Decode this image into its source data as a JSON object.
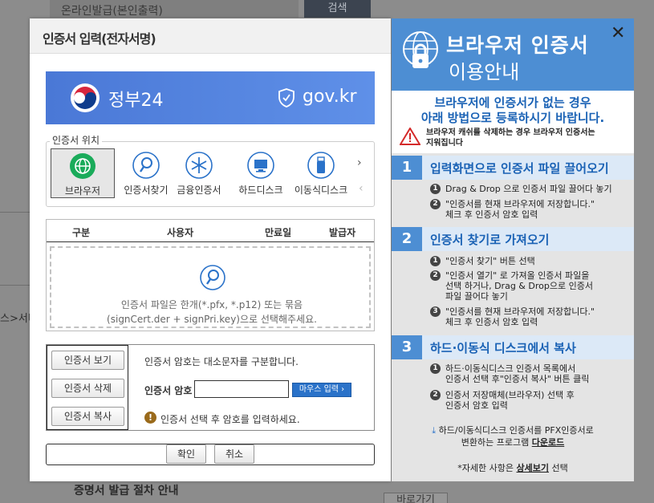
{
  "background": {
    "row_label": "온라인발급(본인출력)",
    "search_label": "검색",
    "crumb": "스>서비",
    "bottom_title": "증명서 발급 절차 안내",
    "bottom_button": "바로가기"
  },
  "dialog": {
    "title": "인증서 입력(전자서명)",
    "banner": {
      "gov_name": "정부24",
      "domain": "gov.kr"
    },
    "location": {
      "legend": "인증서 위치",
      "items": [
        {
          "label": "브라우저",
          "icon": "globe-icon"
        },
        {
          "label": "인증서찾기",
          "icon": "magnifier-icon"
        },
        {
          "label": "금융인증서",
          "icon": "asterisk-icon"
        },
        {
          "label": "하드디스크",
          "icon": "monitor-icon"
        },
        {
          "label": "이동식디스크",
          "icon": "usb-icon"
        }
      ],
      "next_arrow": "›",
      "prev_arrow": "‹"
    },
    "table": {
      "columns": [
        "구분",
        "사용자",
        "만료일",
        "발급자"
      ],
      "drop_line1": "인증서 파일은 한개(*.pfx, *.p12) 또는 묶음",
      "drop_line2": "(signCert.der + signPri.key)으로 선택해주세요."
    },
    "buttons": {
      "view": "인증서 보기",
      "delete": "인증서 삭제",
      "copy": "인증서 복사"
    },
    "password": {
      "note": "인증서 암호는 대소문자를 구분합니다.",
      "label": "인증서 암호",
      "value": "",
      "mouse_input": "마우스 입력",
      "warning": "인증서 선택 후 암호를 입력하세요."
    },
    "footer": {
      "ok": "확인",
      "cancel": "취소"
    }
  },
  "help": {
    "title_line1": "브라우저 인증서",
    "title_line2": "이용안내",
    "close": "✕",
    "sub_line1": "브라우저에 인증서가 없는 경우",
    "sub_line2": "아래 방법으로 등록하시기 바랍니다.",
    "warn_line1": "브라우저 캐쉬를 삭제하는 경우 브라우저 인증서는",
    "warn_line2": "지워집니다",
    "sections": [
      {
        "num": "1",
        "title": "입력화면으로 인증서 파일 끌어오기",
        "steps": [
          {
            "n": "1",
            "lines": [
              "Drag & Drop 으로 인증서 파일 끌어다 놓기"
            ]
          },
          {
            "n": "2",
            "lines": [
              "\"인증서를 현재 브라우저에 저장합니다.\"",
              "체크 후 인증서 암호 입력"
            ]
          }
        ]
      },
      {
        "num": "2",
        "title": "인증서 찾기로 가져오기",
        "steps": [
          {
            "n": "1",
            "lines": [
              "\"인증서 찾기\" 버튼 선택"
            ]
          },
          {
            "n": "2",
            "lines": [
              "\"인증서 열기\" 로 가져올 인증서 파일을",
              "선택 하거나, Drag & Drop으로 인증서",
              "파일 끌어다 놓기"
            ]
          },
          {
            "n": "3",
            "lines": [
              "\"인증서를 현재 브라우저에 저장합니다.\"",
              "체크 후 인증서 암호 입력"
            ]
          }
        ]
      },
      {
        "num": "3",
        "title": "하드·이동식 디스크에서 복사",
        "steps": [
          {
            "n": "1",
            "lines": [
              "하드·이동식디스크 인증서 목록에서",
              "인증서 선택 후\"인증서 복사\" 버튼 클릭"
            ]
          },
          {
            "n": "2",
            "lines": [
              "인증서 저장매체(브라우저) 선택 후",
              "인증서 암호 입력"
            ]
          }
        ]
      }
    ],
    "pfx_line1": "하드/이동식디스크 인증서를 PFX인증서로",
    "pfx_line2_pre": "변환하는 프로그램",
    "pfx_download": "다운로드",
    "detail_pre": "*자세한 사항은",
    "detail_link": "상세보기",
    "detail_post": "선택"
  }
}
